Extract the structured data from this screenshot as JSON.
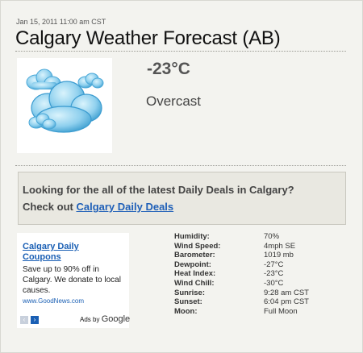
{
  "timestamp": "Jan 15, 2011 11:00 am CST",
  "title": "Calgary Weather Forecast (AB)",
  "current": {
    "temperature": "-23°C",
    "condition": "Overcast",
    "icon": "cloud-icon"
  },
  "deals": {
    "line1": "Looking for the all of the latest Daily Deals in Calgary?",
    "line2_prefix": "Check out",
    "link_text": "Calgary Daily Deals"
  },
  "ad": {
    "title": "Calgary Daily Coupons",
    "body": "Save up to 90% off in Calgary. We donate to local causes.",
    "url": "www.GoodNews.com",
    "prev_icon": "‹",
    "next_icon": "›",
    "ads_by": "Ads by",
    "brand": "Google"
  },
  "stats": [
    {
      "label": "Humidity:",
      "value": "70%"
    },
    {
      "label": "Wind Speed:",
      "value": "4mph SE"
    },
    {
      "label": "Barometer:",
      "value": "1019 mb"
    },
    {
      "label": "Dewpoint:",
      "value": "-27°C"
    },
    {
      "label": "Heat Index:",
      "value": "-23°C"
    },
    {
      "label": "Wind Chill:",
      "value": "-30°C"
    },
    {
      "label": "Sunrise:",
      "value": "9:28 am CST"
    },
    {
      "label": "Sunset:",
      "value": "6:04 pm CST"
    },
    {
      "label": "Moon:",
      "value": "Full Moon"
    }
  ],
  "colors": {
    "link": "#2060b8",
    "deals_bg": "#e9e8e1",
    "cloud": "#8fd0ee"
  }
}
